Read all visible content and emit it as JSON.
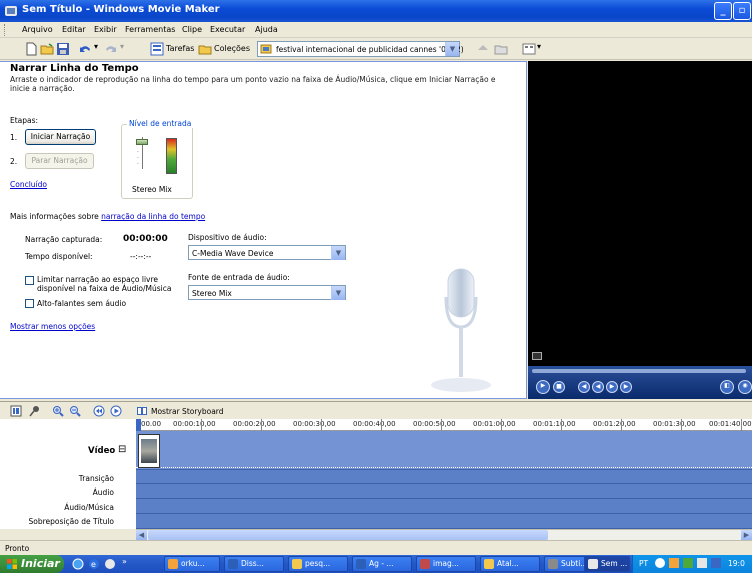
{
  "window": {
    "title": "Sem Título - Windows Movie Maker"
  },
  "menu": [
    "Arquivo",
    "Editar",
    "Exibir",
    "Ferramentas",
    "Clipe",
    "Executar",
    "Ajuda"
  ],
  "toolbar": {
    "tasks_label": "Tarefas",
    "collections_label": "Coleções",
    "collection_value": "festival internacional de publicidad cannes '04 (2)"
  },
  "narration": {
    "title": "Narrar Linha do Tempo",
    "instructions": "Arraste o indicador de reprodução na linha do tempo para um ponto vazio na faixa de Áudio/Música, clique em Iniciar Narração e inicie a narração.",
    "steps_label": "Etapas:",
    "step1_number": "1.",
    "step2_number": "2.",
    "start_button": "Iniciar Narração",
    "stop_button": "Parar Narração",
    "done_link": "Concluído",
    "input_level_label": "Nível de entrada",
    "input_level_source": "Stereo Mix",
    "more_info_prefix": "Mais informações sobre ",
    "more_info_link": "narração da linha do tempo",
    "captured_label": "Narração capturada:",
    "captured_value": "00:00:00",
    "available_label": "Tempo disponível:",
    "available_value": "--:--:--",
    "audio_device_label": "Dispositivo de áudio:",
    "audio_device_value": "C-Media Wave Device",
    "audio_input_label": "Fonte de entrada de áudio:",
    "audio_input_value": "Stereo Mix",
    "limit_checkbox_label_1": "Limitar narração ao espaço livre",
    "limit_checkbox_label_2": "disponível na faixa de Áudio/Música",
    "mute_checkbox_label": "Alto-falantes sem áudio",
    "fewer_options_link": "Mostrar menos opções"
  },
  "timeline": {
    "storyboard_label": "Mostrar Storyboard",
    "ruler_ticks": [
      "00.00",
      "00:00:10,00",
      "00:00:20,00",
      "00:00:30,00",
      "00:00:40,00",
      "00:00:50,00",
      "00:01:00,00",
      "00:01:10,00",
      "00:01:20,00",
      "00:01:30,00",
      "00:01:40,00"
    ],
    "tracks": [
      "Vídeo",
      "Transição",
      "Áudio",
      "Áudio/Música",
      "Sobreposição de Título"
    ],
    "video_expand": "⊟"
  },
  "status": {
    "text": "Pronto"
  },
  "taskbar": {
    "start_label": "Iniciar",
    "buttons": [
      "orku...",
      "Diss...",
      "pesq...",
      "Ag - ...",
      "imag...",
      "Atal...",
      "Subti...",
      "Sem ..."
    ],
    "language": "PT",
    "clock": "19:0"
  },
  "colors": {
    "title_bar": "#0b4bd6",
    "timeline_track": "#5c80c8",
    "link": "#0000cc"
  }
}
